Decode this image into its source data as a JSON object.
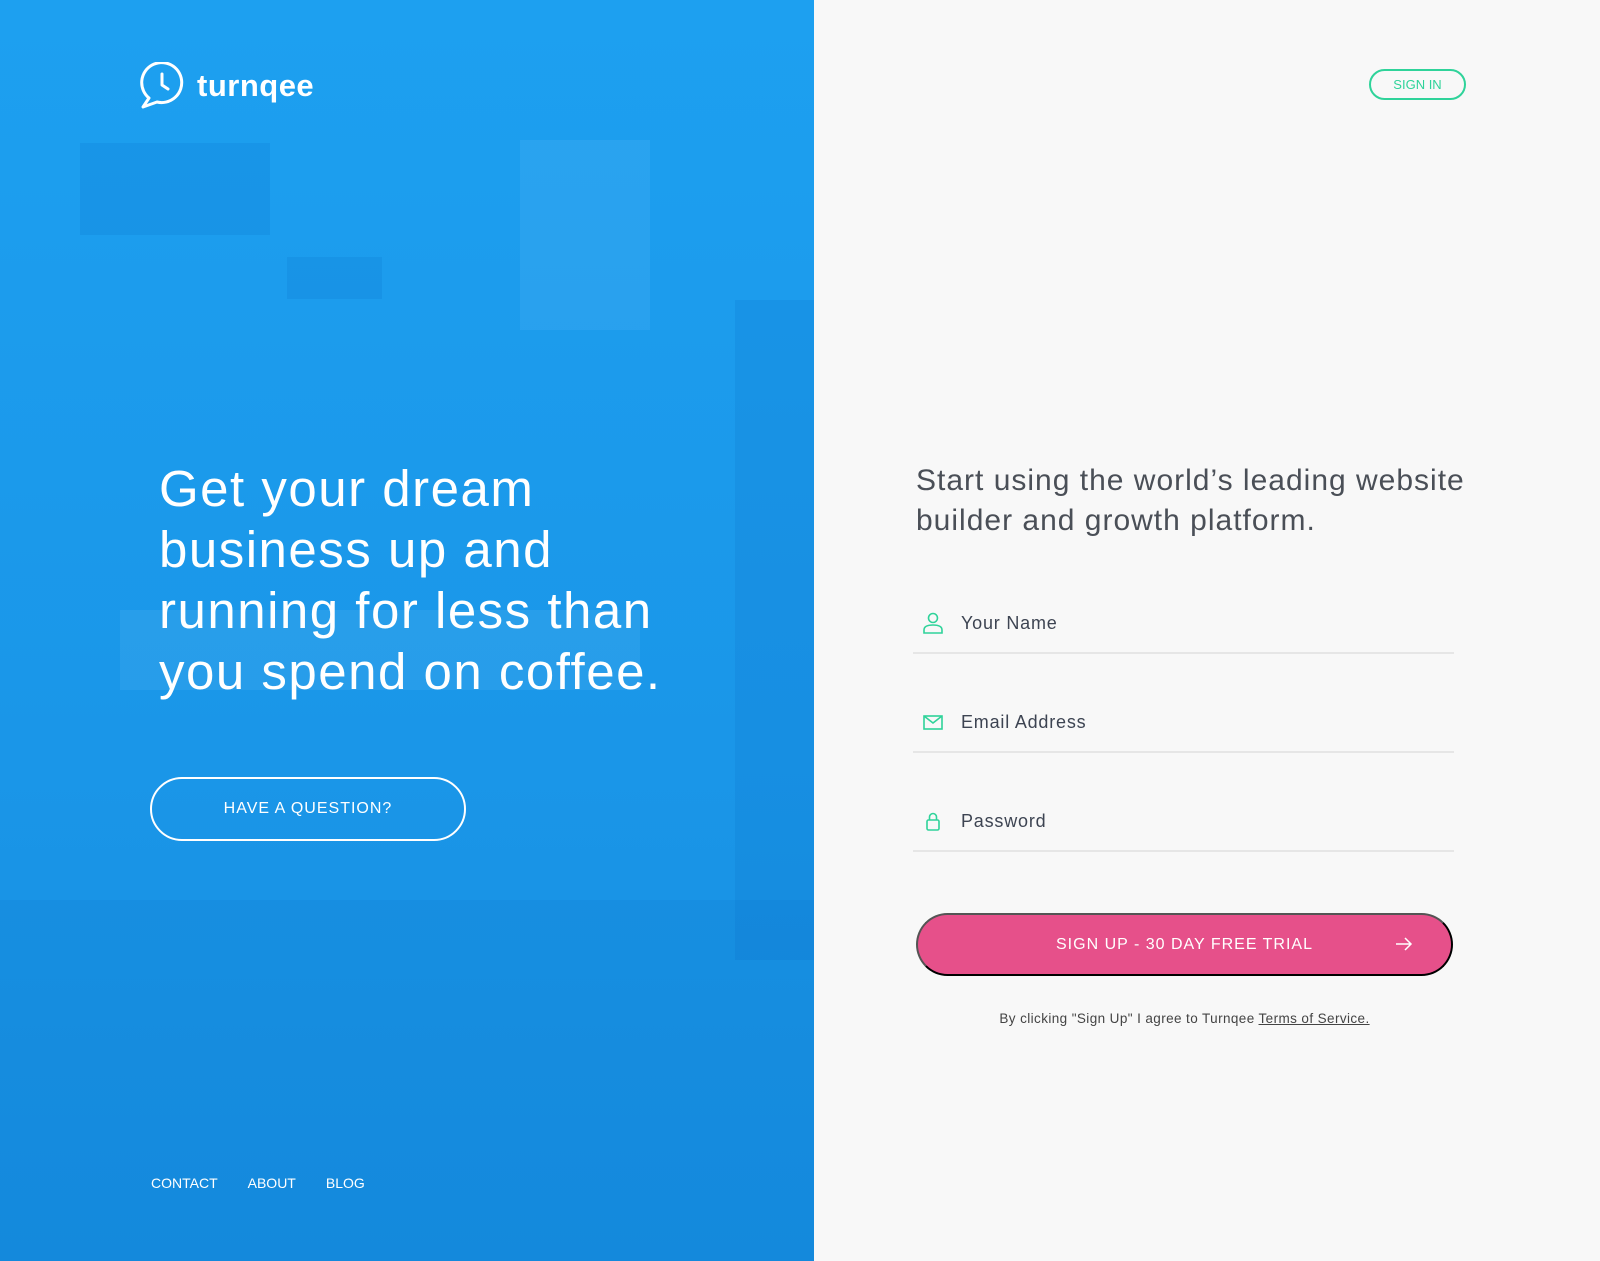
{
  "brand": {
    "name": "turnqee",
    "colors": {
      "panel": "#1b9ded",
      "accent": "#2fd39a",
      "cta": "#e6508a"
    }
  },
  "hero": {
    "headline": "Get your dream business up and running for less than you spend on coffee.",
    "question_button": "HAVE A QUESTION?"
  },
  "footer": {
    "links": [
      "CONTACT",
      "ABOUT",
      "BLOG"
    ]
  },
  "header": {
    "sign_in": "SIGN IN"
  },
  "form": {
    "tagline": "Start using the world’s leading website builder and growth platform.",
    "fields": [
      {
        "icon": "user-icon",
        "placeholder": "Your Name"
      },
      {
        "icon": "envelope-icon",
        "placeholder": "Email Address"
      },
      {
        "icon": "lock-icon",
        "placeholder": "Password"
      }
    ],
    "submit": "SIGN UP - 30 DAY FREE TRIAL",
    "terms_prefix": "By clicking \"Sign Up\" I agree to Turnqee ",
    "terms_link": "Terms of Service."
  }
}
